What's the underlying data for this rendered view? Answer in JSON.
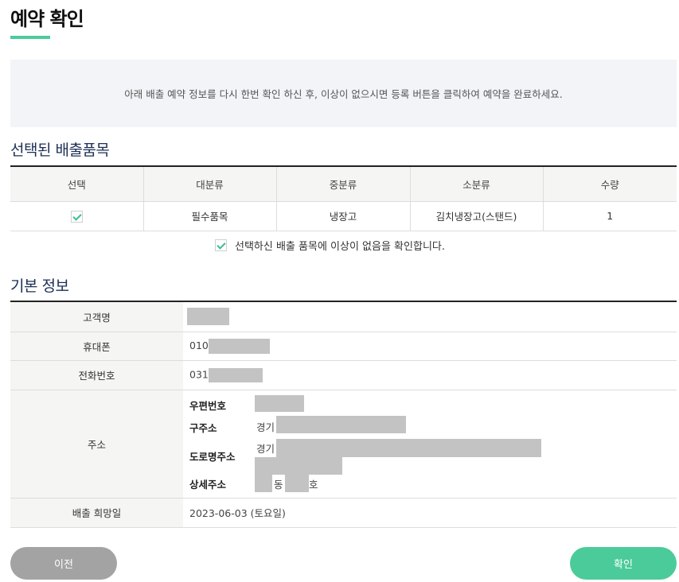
{
  "page": {
    "title": "예약 확인"
  },
  "notice": "아래 배출 예약 정보를 다시 한번 확인 하신 후, 이상이 없으시면 등록 버튼을 클릭하여 예약을 완료하세요.",
  "items_section": {
    "title": "선택된 배출품목",
    "columns": [
      "선택",
      "대분류",
      "중분류",
      "소분류",
      "수량"
    ],
    "rows": [
      {
        "checked": true,
        "major": "필수품목",
        "middle": "냉장고",
        "minor": "김치냉장고(스탠드)",
        "qty": "1"
      }
    ],
    "confirm_label": "선택하신 배출 품목에 이상이 없음을 확인합니다.",
    "confirm_checked": true
  },
  "info_section": {
    "title": "기본 정보",
    "labels": {
      "name": "고객명",
      "mobile": "휴대폰",
      "phone": "전화번호",
      "address": "주소",
      "date": "배출 희망일"
    },
    "mobile_prefix": "010",
    "phone_prefix": "031",
    "address": {
      "zip_label": "우편번호",
      "old_label": "구주소",
      "old_prefix": "경기",
      "road_label": "도로명주소",
      "road_prefix": "경기",
      "detail_label": "상세주소",
      "detail_dong": "동",
      "detail_ho": "호"
    },
    "date_value": "2023-06-03 (토요일)"
  },
  "buttons": {
    "prev": "이전",
    "ok": "확인"
  },
  "colors": {
    "accent": "#4ccb9a",
    "navy": "#1c2f55",
    "mask": "#c3c3c3",
    "prev_button": "#a3a3a3"
  }
}
